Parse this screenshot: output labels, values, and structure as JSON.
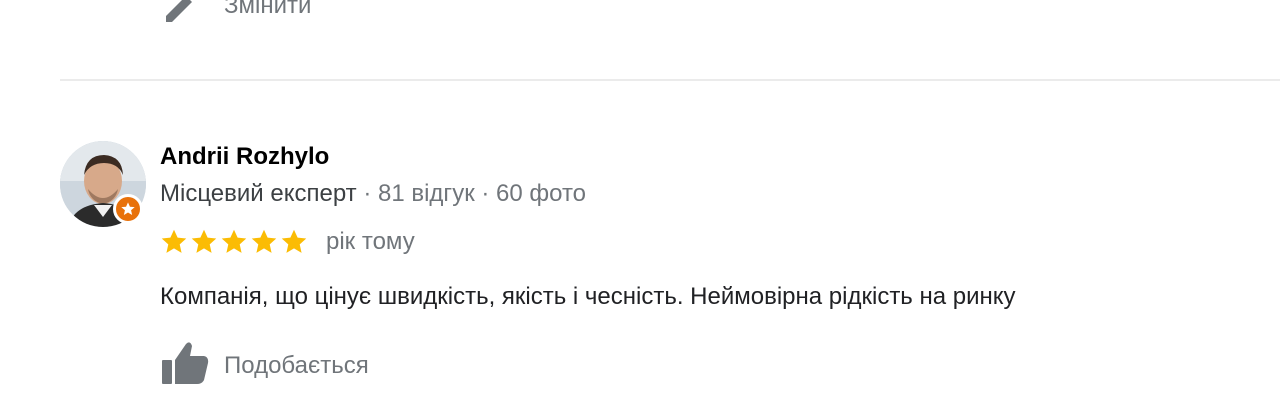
{
  "top_action": {
    "label": "Змінити",
    "icon": "pencil-icon"
  },
  "review": {
    "author": {
      "name": "Andrii Rozhylo",
      "level": "Місцевий експерт",
      "separator": " · ",
      "reviews_count": "81 відгук",
      "photos_count": "60 фото",
      "avatar_icon": "avatar-photo",
      "badge_icon": "local-guide-star-icon"
    },
    "rating": {
      "stars": 5,
      "max": 5,
      "star_color": "#fbbc04",
      "time": "рік тому"
    },
    "text": "Компанія, що цінує швидкість, якість і чесність. Неймовірна рідкість на ринку",
    "like": {
      "label": "Подобається",
      "icon": "thumbs-up-icon"
    }
  },
  "colors": {
    "secondary_text": "#70757a",
    "badge": "#e8710a",
    "divider": "#ebebeb"
  }
}
